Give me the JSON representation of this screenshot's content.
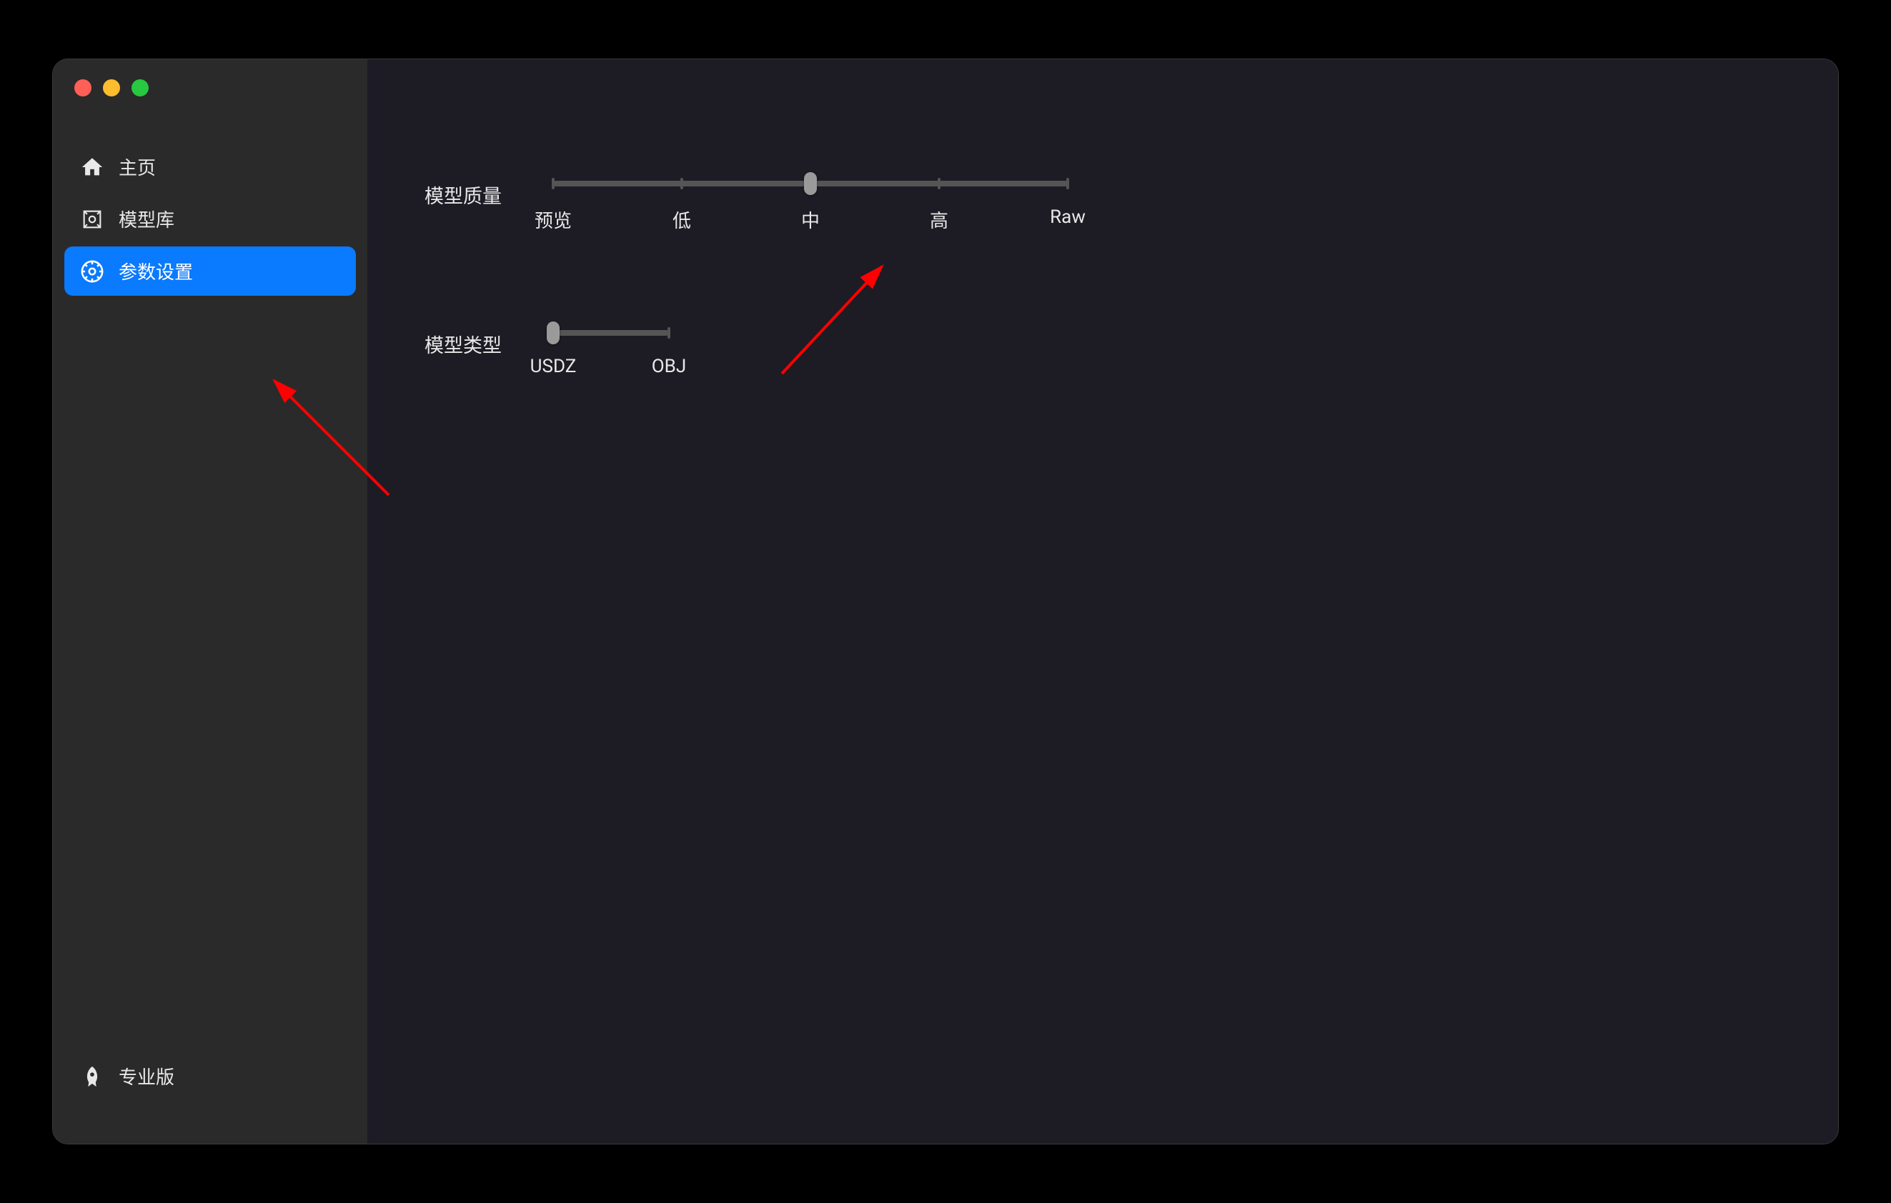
{
  "sidebar": {
    "items": [
      {
        "label": "主页",
        "icon": "home-icon"
      },
      {
        "label": "模型库",
        "icon": "cube-icon"
      },
      {
        "label": "参数设置",
        "icon": "gear-icon"
      }
    ],
    "active_index": 2,
    "footer": {
      "label": "专业版",
      "icon": "rocket-icon"
    }
  },
  "settings": {
    "quality": {
      "label": "模型质量",
      "options": [
        "预览",
        "低",
        "中",
        "高",
        "Raw"
      ],
      "selected_index": 2
    },
    "type": {
      "label": "模型类型",
      "options": [
        "USDZ",
        "OBJ"
      ],
      "selected_index": 0
    }
  },
  "colors": {
    "accent": "#0a7aff",
    "sidebar_bg": "#2a2a2a",
    "main_bg": "#1d1b24"
  }
}
